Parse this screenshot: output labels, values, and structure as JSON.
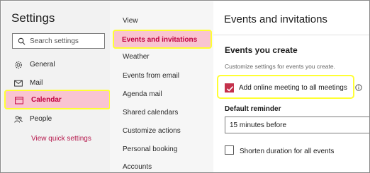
{
  "settings": {
    "title": "Settings",
    "search_placeholder": "Search settings",
    "nav": [
      {
        "label": "General",
        "icon": "gear-icon"
      },
      {
        "label": "Mail",
        "icon": "mail-icon"
      },
      {
        "label": "Calendar",
        "icon": "calendar-icon",
        "active": true
      },
      {
        "label": "People",
        "icon": "people-icon"
      }
    ],
    "quick_settings_link": "View quick settings"
  },
  "calendar_nav": {
    "items": [
      {
        "label": "View"
      },
      {
        "label": "Events and invitations",
        "active": true
      },
      {
        "label": "Weather"
      },
      {
        "label": "Events from email"
      },
      {
        "label": "Agenda mail"
      },
      {
        "label": "Shared calendars"
      },
      {
        "label": "Customize actions"
      },
      {
        "label": "Personal booking"
      },
      {
        "label": "Accounts"
      }
    ]
  },
  "panel": {
    "title": "Events and invitations",
    "section_title": "Events you create",
    "section_description": "Customize settings for events you create.",
    "online_meeting_label": "Add online meeting to all meetings",
    "online_meeting_checked": true,
    "reminder_label": "Default reminder",
    "reminder_value": "15 minutes before",
    "shorten_label": "Shorten duration for all events",
    "shorten_checked": false
  },
  "colors": {
    "accent": "#c4314b",
    "highlight": "#ffff33",
    "selected_bg": "#f9c4d1"
  }
}
